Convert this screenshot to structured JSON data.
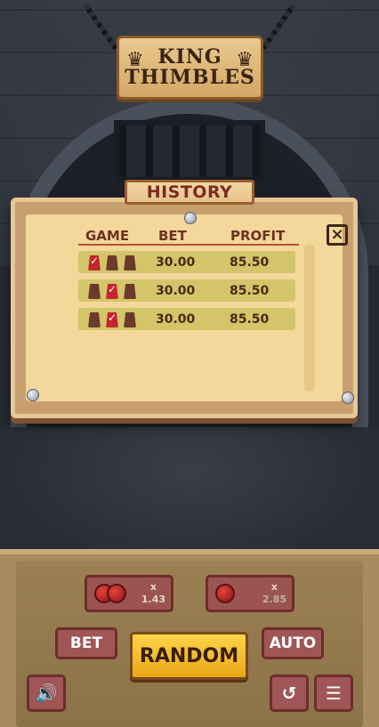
{
  "logo": {
    "line1": "KING",
    "line2": "THIMBLES"
  },
  "history": {
    "title": "HISTORY",
    "close_icon": "×",
    "columns": [
      "GAME",
      "BET",
      "PROFIT"
    ],
    "rows": [
      {
        "cups": [
          true,
          false,
          false
        ],
        "bet": "30.00",
        "profit": "85.50"
      },
      {
        "cups": [
          false,
          true,
          false
        ],
        "bet": "30.00",
        "profit": "85.50"
      },
      {
        "cups": [
          false,
          true,
          false
        ],
        "bet": "30.00",
        "profit": "85.50"
      }
    ]
  },
  "controls": {
    "stat_left": {
      "balls": 2,
      "x": "x",
      "multiplier": "1.43"
    },
    "stat_right": {
      "balls": 1,
      "x": "x",
      "multiplier": "2.85"
    },
    "bet_label": "BET",
    "random_label": "RANDOM",
    "auto_label": "AUTO",
    "sound_icon": "speaker-icon",
    "history_icon": "history-icon",
    "menu_icon": "menu-icon"
  },
  "colors": {
    "cup_win": "#c4262d",
    "cup_default": "#6a3a2a",
    "row_bg": "#d4c56a",
    "random_button": "#ffd34a"
  }
}
